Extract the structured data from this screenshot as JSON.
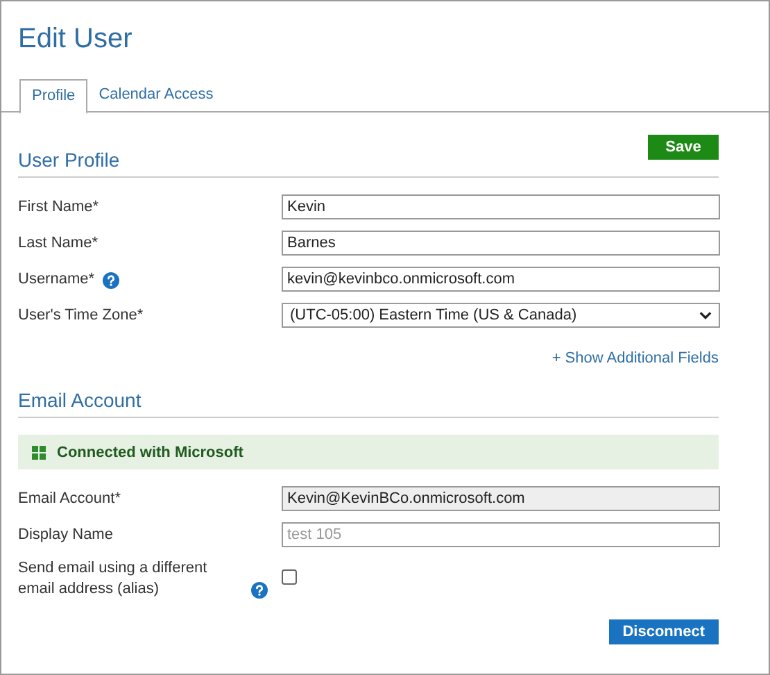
{
  "page": {
    "title": "Edit User"
  },
  "tabs": [
    {
      "label": "Profile",
      "selected": true
    },
    {
      "label": "Calendar Access",
      "selected": false
    }
  ],
  "sections": [
    {
      "heading": "User Profile",
      "action": {
        "label": "Save",
        "kind": "save"
      },
      "fields": [
        {
          "kind": "text",
          "label": "First Name*",
          "value": "Kevin",
          "disabled": false
        },
        {
          "kind": "text",
          "label": "Last Name*",
          "value": "Barnes",
          "disabled": false
        },
        {
          "kind": "text",
          "label": "Username*",
          "value": "kevin@kevinbco.onmicrosoft.com",
          "help": true,
          "disabled": false
        },
        {
          "kind": "select",
          "label": "User's Time Zone*",
          "value": "(UTC-05:00) Eastern Time (US & Canada)"
        }
      ],
      "link": "+ Show Additional Fields"
    },
    {
      "heading": "Email Account",
      "banner": "Connected with Microsoft",
      "fields": [
        {
          "kind": "text",
          "label": "Email Account*",
          "value": "Kevin@KevinBCo.onmicrosoft.com",
          "disabled": true
        },
        {
          "kind": "text",
          "label": "Display Name",
          "placeholder": "test 105",
          "disabled": false
        },
        {
          "kind": "checkbox",
          "label": "Send email using a different email address (alias)",
          "checked": false,
          "help": true
        }
      ],
      "footer_action": {
        "label": "Disconnect",
        "kind": "primary"
      }
    }
  ]
}
